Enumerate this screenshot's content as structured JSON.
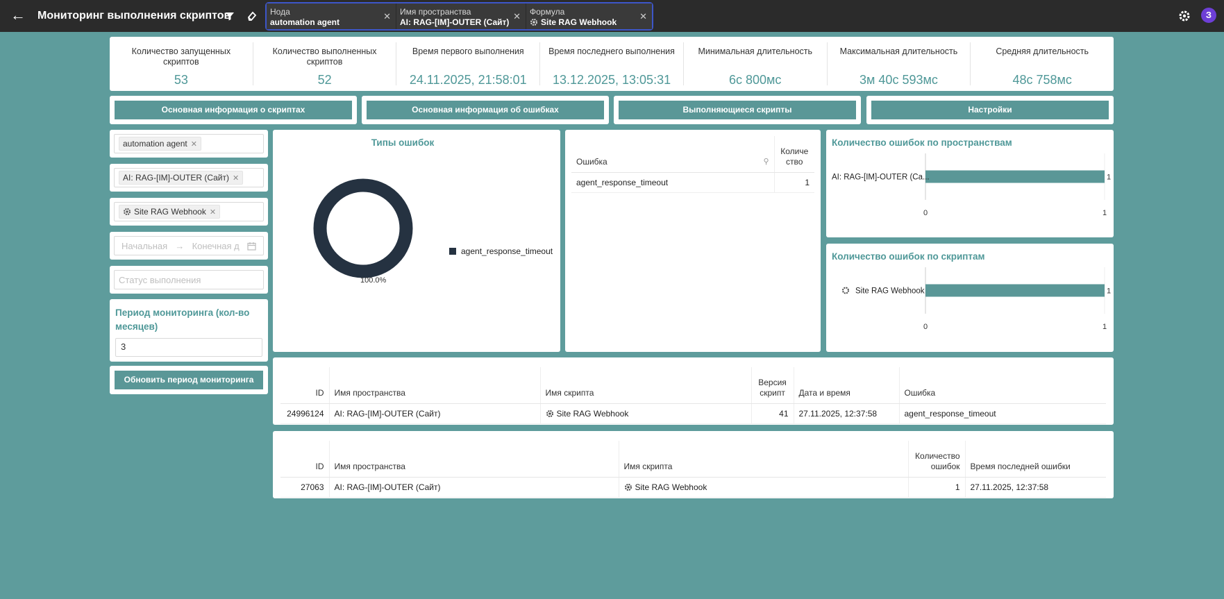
{
  "header": {
    "title": "Мониторинг выполнения скриптов",
    "chips": [
      {
        "label": "Нода",
        "value": "automation agent"
      },
      {
        "label": "Имя пространства",
        "value": "AI: RAG-[IM]-OUTER (Сайт)"
      },
      {
        "label": "Формула",
        "value": "Site RAG Webhook"
      }
    ],
    "avatar": "З"
  },
  "stats": [
    {
      "label": "Количество запущенных скриптов",
      "value": "53"
    },
    {
      "label": "Количество выполненных скриптов",
      "value": "52"
    },
    {
      "label": "Время первого выполнения",
      "value": "24.11.2025, 21:58:01"
    },
    {
      "label": "Время последнего выполнения",
      "value": "13.12.2025, 13:05:31"
    },
    {
      "label": "Минимальная длительность",
      "value": "6с 800мс"
    },
    {
      "label": "Максимальная длительность",
      "value": "3м 40с 593мс"
    },
    {
      "label": "Средняя длительность",
      "value": "48с 758мс"
    }
  ],
  "tabs": [
    "Основная информация о скриптах",
    "Основная информация об ошибках",
    "Выполняющиеся скрипты",
    "Настройки"
  ],
  "filters": {
    "node_tag": "automation agent",
    "space_tag": "AI: RAG-[IM]-OUTER (Сайт)",
    "formula_tag": "Site RAG Webhook",
    "date_start_placeholder": "Начальная",
    "date_end_placeholder": "Конечная д",
    "status_placeholder": "Статус выполнения",
    "period_title": "Период мониторинга (кол-во месяцев)",
    "period_value": "3",
    "update_button": "Обновить период мониторинга"
  },
  "error_types": {
    "title": "Типы ошибок",
    "legend": "agent_response_timeout",
    "percent_label": "100.0%",
    "color": "#253241"
  },
  "error_table": {
    "col_error": "Ошибка",
    "col_count": "Количество",
    "rows": [
      {
        "error": "agent_response_timeout",
        "count": "1"
      }
    ]
  },
  "chart_data": [
    {
      "type": "bar",
      "title": "Типы ошибок",
      "categories": [
        "agent_response_timeout"
      ],
      "values": [
        1
      ],
      "note_label": "100.0%"
    },
    {
      "type": "bar",
      "title": "Количество ошибок по пространствам",
      "categories": [
        "AI: RAG-[IM]-OUTER (Ca..."
      ],
      "values": [
        1
      ],
      "xlim": [
        0,
        1
      ],
      "ticks": [
        "0",
        "1"
      ],
      "value_label": "1"
    },
    {
      "type": "bar",
      "title": "Количество ошибок по скриптам",
      "categories": [
        "Site RAG Webhook"
      ],
      "values": [
        1
      ],
      "xlim": [
        0,
        1
      ],
      "ticks": [
        "0",
        "1"
      ],
      "value_label": "1"
    }
  ],
  "errors_detail": {
    "headers": [
      "ID",
      "Имя пространства",
      "Имя скрипта",
      "Версия скрипт",
      "Дата и время",
      "Ошибка"
    ],
    "rows": [
      {
        "id": "24996124",
        "space": "AI: RAG-[IM]-OUTER (Сайт)",
        "script": "Site RAG Webhook",
        "version": "41",
        "datetime": "27.11.2025, 12:37:58",
        "error": "agent_response_timeout"
      }
    ]
  },
  "scripts_summary": {
    "headers": [
      "ID",
      "Имя пространства",
      "Имя скрипта",
      "Количество ошибок",
      "Время последней ошибки"
    ],
    "rows": [
      {
        "id": "27063",
        "space": "AI: RAG-[IM]-OUTER (Сайт)",
        "script": "Site RAG Webhook",
        "count": "1",
        "last": "27.11.2025, 12:37:58"
      }
    ]
  },
  "colors": {
    "accent": "#5a9797",
    "background": "#5e9c9c",
    "topbar": "#2b2b2b",
    "chip_border": "#3d56c9",
    "avatar": "#6d3fd6"
  }
}
